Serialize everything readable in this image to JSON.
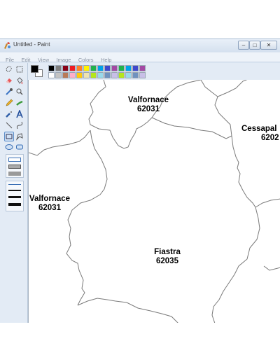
{
  "window": {
    "title": "Untitled - Paint",
    "controls": {
      "minimize": "–",
      "maximize": "□",
      "close": "✕"
    }
  },
  "menu": [
    "File",
    "Edit",
    "View",
    "Image",
    "Colors",
    "Help"
  ],
  "palette": {
    "primary": "#000000",
    "secondary": "#ffffff",
    "row1": [
      "#000000",
      "#7f7f7f",
      "#880015",
      "#ed1c24",
      "#ff7f27",
      "#fff200",
      "#22b14c",
      "#00a2e8",
      "#3f48cc",
      "#a349a4",
      "#22b14c",
      "#00a2e8",
      "#3f48cc",
      "#a349a4"
    ],
    "row2": [
      "#ffffff",
      "#c3c3c3",
      "#b97a57",
      "#ffaec9",
      "#ffc90e",
      "#efe4b0",
      "#b5e61d",
      "#99d9ea",
      "#7092be",
      "#c8bfe7",
      "#b5e61d",
      "#99d9ea",
      "#7092be",
      "#c8bfe7"
    ]
  },
  "tools": [
    "free-select-icon",
    "rect-select-icon",
    "eraser-icon",
    "fill-icon",
    "color-picker-icon",
    "magnifier-icon",
    "pencil-icon",
    "brush-icon",
    "airbrush-icon",
    "text-icon",
    "line-icon",
    "curve-icon",
    "rectangle-icon",
    "polygon-icon",
    "ellipse-icon",
    "rounded-rect-icon"
  ],
  "map": {
    "labels": [
      {
        "name": "Valfornace",
        "code": "62031"
      },
      {
        "name": "Cessapal",
        "code": "6202"
      },
      {
        "name": "Valfornace",
        "code": "62031"
      },
      {
        "name": "Fiastra",
        "code": "62035"
      }
    ]
  }
}
